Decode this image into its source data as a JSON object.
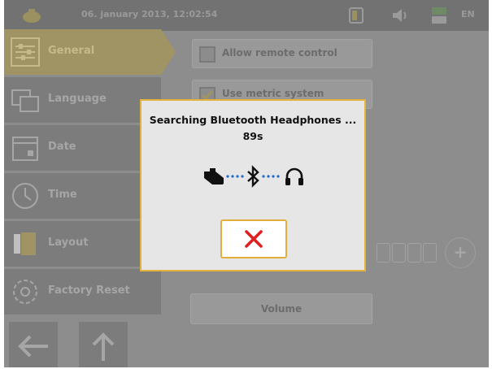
{
  "topbar": {
    "datetime": "06. january 2013, 12:02:54",
    "language": "EN"
  },
  "sidebar": {
    "items": [
      {
        "label": "General",
        "icon": "sliders-icon",
        "active": true
      },
      {
        "label": "Language",
        "icon": "language-icon",
        "active": false
      },
      {
        "label": "Date",
        "icon": "calendar-icon",
        "active": false
      },
      {
        "label": "Time",
        "icon": "clock-icon",
        "active": false
      },
      {
        "label": "Layout",
        "icon": "layout-icon",
        "active": false
      },
      {
        "label": "Factory Reset",
        "icon": "gear-icon",
        "active": false
      }
    ]
  },
  "options": {
    "allow_remote_control": {
      "label": "Allow remote control",
      "checked": false
    },
    "use_metric_system": {
      "label": "Use metric system",
      "checked": true
    }
  },
  "volume": {
    "label": "Volume"
  },
  "dialog": {
    "title": "Searching Bluetooth Headphones ...",
    "timer": "89s"
  },
  "colors": {
    "accent": "#e5b23b",
    "cancel_x": "#e01f1f",
    "dots": "#1e6bc7"
  }
}
